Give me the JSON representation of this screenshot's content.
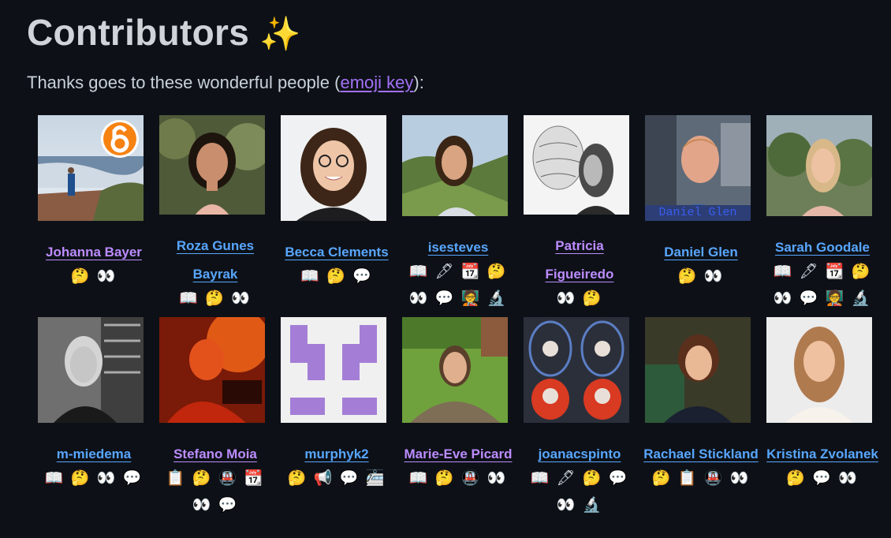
{
  "header": {
    "title": "Contributors",
    "title_emoji": "✨",
    "thanks_prefix": "Thanks goes to these wonderful people (",
    "emoji_key_link": "emoji key",
    "thanks_suffix": "):"
  },
  "contributors": [
    {
      "name": "Johanna Bayer",
      "color": "purple",
      "badges": "🤔 👀"
    },
    {
      "name": "Roza Gunes Bayrak",
      "color": "blue",
      "badges": "📖 🤔 👀"
    },
    {
      "name": "Becca Clements",
      "color": "blue",
      "badges": "📖 🤔 💬"
    },
    {
      "name": "isesteves",
      "color": "blue",
      "badges": "📖 🖋 📆 🤔 👀 💬 🧑‍🏫 🔬"
    },
    {
      "name": "Patricia Figueiredo",
      "color": "purple",
      "badges": "👀 🤔"
    },
    {
      "name": "Daniel Glen",
      "color": "blue",
      "badges": "🤔 👀"
    },
    {
      "name": "Sarah Goodale",
      "color": "blue",
      "badges": "📖 🖋 📆 🤔 👀 💬 🧑‍🏫 🔬"
    },
    {
      "name": "m-miedema",
      "color": "blue",
      "badges": "📖 🤔 👀 💬"
    },
    {
      "name": "Stefano Moia",
      "color": "purple",
      "badges": "📋 🤔 🚇 📆 👀 💬"
    },
    {
      "name": "murphyk2",
      "color": "blue",
      "badges": "🤔 📢 💬 🚈"
    },
    {
      "name": "Marie-Eve Picard",
      "color": "purple",
      "badges": "📖 🤔 🚇 👀"
    },
    {
      "name": "joanacspinto",
      "color": "blue",
      "badges": "📖 🖋 🤔 💬 👀 🔬"
    },
    {
      "name": "Rachael Stickland",
      "color": "blue",
      "badges": "🤔 📋 🚇 👀"
    },
    {
      "name": "Kristina Zvolanek",
      "color": "blue",
      "badges": "🤔 💬 👀"
    }
  ],
  "avatars": {
    "daniel_caption": "Daniel Glen"
  },
  "colors": {
    "background": "#0d1117",
    "link_blue": "#58a6ff",
    "link_purple": "#bc8cff",
    "murphy_purple": "#a47ed6"
  }
}
